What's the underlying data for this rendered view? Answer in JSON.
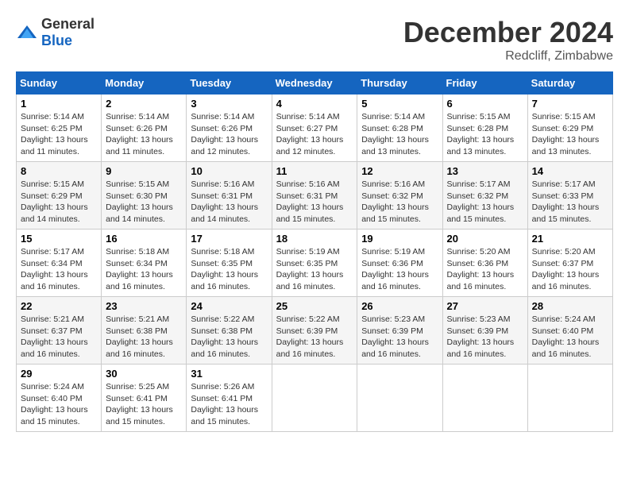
{
  "logo": {
    "text_general": "General",
    "text_blue": "Blue"
  },
  "title": "December 2024",
  "location": "Redcliff, Zimbabwe",
  "days_of_week": [
    "Sunday",
    "Monday",
    "Tuesday",
    "Wednesday",
    "Thursday",
    "Friday",
    "Saturday"
  ],
  "weeks": [
    [
      {
        "day": "1",
        "sunrise": "5:14 AM",
        "sunset": "6:25 PM",
        "daylight": "13 hours and 11 minutes."
      },
      {
        "day": "2",
        "sunrise": "5:14 AM",
        "sunset": "6:26 PM",
        "daylight": "13 hours and 11 minutes."
      },
      {
        "day": "3",
        "sunrise": "5:14 AM",
        "sunset": "6:26 PM",
        "daylight": "13 hours and 12 minutes."
      },
      {
        "day": "4",
        "sunrise": "5:14 AM",
        "sunset": "6:27 PM",
        "daylight": "13 hours and 12 minutes."
      },
      {
        "day": "5",
        "sunrise": "5:14 AM",
        "sunset": "6:28 PM",
        "daylight": "13 hours and 13 minutes."
      },
      {
        "day": "6",
        "sunrise": "5:15 AM",
        "sunset": "6:28 PM",
        "daylight": "13 hours and 13 minutes."
      },
      {
        "day": "7",
        "sunrise": "5:15 AM",
        "sunset": "6:29 PM",
        "daylight": "13 hours and 13 minutes."
      }
    ],
    [
      {
        "day": "8",
        "sunrise": "5:15 AM",
        "sunset": "6:29 PM",
        "daylight": "13 hours and 14 minutes."
      },
      {
        "day": "9",
        "sunrise": "5:15 AM",
        "sunset": "6:30 PM",
        "daylight": "13 hours and 14 minutes."
      },
      {
        "day": "10",
        "sunrise": "5:16 AM",
        "sunset": "6:31 PM",
        "daylight": "13 hours and 14 minutes."
      },
      {
        "day": "11",
        "sunrise": "5:16 AM",
        "sunset": "6:31 PM",
        "daylight": "13 hours and 15 minutes."
      },
      {
        "day": "12",
        "sunrise": "5:16 AM",
        "sunset": "6:32 PM",
        "daylight": "13 hours and 15 minutes."
      },
      {
        "day": "13",
        "sunrise": "5:17 AM",
        "sunset": "6:32 PM",
        "daylight": "13 hours and 15 minutes."
      },
      {
        "day": "14",
        "sunrise": "5:17 AM",
        "sunset": "6:33 PM",
        "daylight": "13 hours and 15 minutes."
      }
    ],
    [
      {
        "day": "15",
        "sunrise": "5:17 AM",
        "sunset": "6:34 PM",
        "daylight": "13 hours and 16 minutes."
      },
      {
        "day": "16",
        "sunrise": "5:18 AM",
        "sunset": "6:34 PM",
        "daylight": "13 hours and 16 minutes."
      },
      {
        "day": "17",
        "sunrise": "5:18 AM",
        "sunset": "6:35 PM",
        "daylight": "13 hours and 16 minutes."
      },
      {
        "day": "18",
        "sunrise": "5:19 AM",
        "sunset": "6:35 PM",
        "daylight": "13 hours and 16 minutes."
      },
      {
        "day": "19",
        "sunrise": "5:19 AM",
        "sunset": "6:36 PM",
        "daylight": "13 hours and 16 minutes."
      },
      {
        "day": "20",
        "sunrise": "5:20 AM",
        "sunset": "6:36 PM",
        "daylight": "13 hours and 16 minutes."
      },
      {
        "day": "21",
        "sunrise": "5:20 AM",
        "sunset": "6:37 PM",
        "daylight": "13 hours and 16 minutes."
      }
    ],
    [
      {
        "day": "22",
        "sunrise": "5:21 AM",
        "sunset": "6:37 PM",
        "daylight": "13 hours and 16 minutes."
      },
      {
        "day": "23",
        "sunrise": "5:21 AM",
        "sunset": "6:38 PM",
        "daylight": "13 hours and 16 minutes."
      },
      {
        "day": "24",
        "sunrise": "5:22 AM",
        "sunset": "6:38 PM",
        "daylight": "13 hours and 16 minutes."
      },
      {
        "day": "25",
        "sunrise": "5:22 AM",
        "sunset": "6:39 PM",
        "daylight": "13 hours and 16 minutes."
      },
      {
        "day": "26",
        "sunrise": "5:23 AM",
        "sunset": "6:39 PM",
        "daylight": "13 hours and 16 minutes."
      },
      {
        "day": "27",
        "sunrise": "5:23 AM",
        "sunset": "6:39 PM",
        "daylight": "13 hours and 16 minutes."
      },
      {
        "day": "28",
        "sunrise": "5:24 AM",
        "sunset": "6:40 PM",
        "daylight": "13 hours and 16 minutes."
      }
    ],
    [
      {
        "day": "29",
        "sunrise": "5:24 AM",
        "sunset": "6:40 PM",
        "daylight": "13 hours and 15 minutes."
      },
      {
        "day": "30",
        "sunrise": "5:25 AM",
        "sunset": "6:41 PM",
        "daylight": "13 hours and 15 minutes."
      },
      {
        "day": "31",
        "sunrise": "5:26 AM",
        "sunset": "6:41 PM",
        "daylight": "13 hours and 15 minutes."
      },
      null,
      null,
      null,
      null
    ]
  ]
}
